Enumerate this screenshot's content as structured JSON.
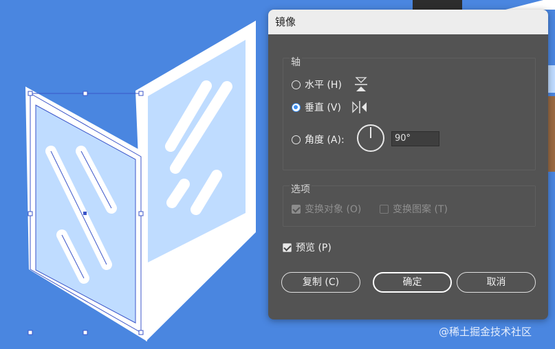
{
  "dialog": {
    "title": "镜像",
    "axis_group": {
      "label": "轴",
      "horizontal": {
        "label": "水平 (H)",
        "selected": false,
        "icon": "mirror-horizontal-icon"
      },
      "vertical": {
        "label": "垂直 (V)",
        "selected": true,
        "icon": "mirror-vertical-icon"
      },
      "angle": {
        "label": "角度 (A):",
        "selected": false,
        "value": "90°",
        "icon": "angle-dial-icon"
      }
    },
    "options_group": {
      "label": "选项",
      "transform_objects": {
        "label": "变换对象 (O)",
        "checked": true,
        "enabled": false
      },
      "transform_patterns": {
        "label": "变换图案 (T)",
        "checked": false,
        "enabled": false
      }
    },
    "preview": {
      "label": "预览 (P)",
      "checked": true
    },
    "buttons": {
      "copy": "复制 (C)",
      "ok": "确定",
      "cancel": "取消"
    }
  },
  "watermark": "@稀土掘金技术社区",
  "colors": {
    "canvas_bg": "#4a86e0",
    "panel_frame": "#ffffff",
    "glass": "#bfdcff",
    "selection": "#3b55c9",
    "dialog_bg": "#535353",
    "accent": "#3d8ef0"
  }
}
